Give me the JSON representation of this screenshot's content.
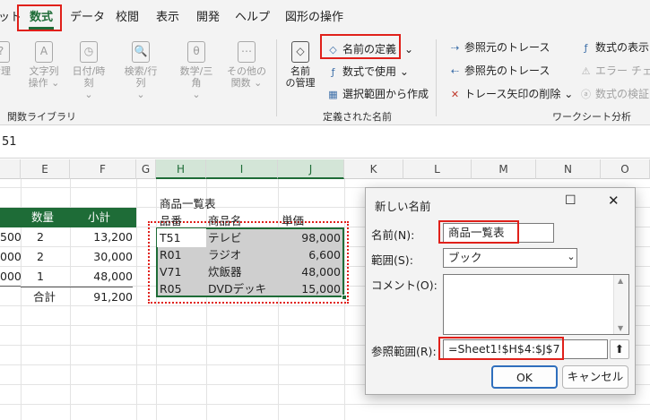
{
  "tabs": [
    {
      "label": "ット",
      "key": "layout"
    },
    {
      "label": "数式",
      "key": "formulas"
    },
    {
      "label": "データ",
      "key": "data"
    },
    {
      "label": "校閲",
      "key": "review"
    },
    {
      "label": "表示",
      "key": "view"
    },
    {
      "label": "開発",
      "key": "developer"
    },
    {
      "label": "ヘルプ",
      "key": "help"
    },
    {
      "label": "図形の操作",
      "key": "shape"
    }
  ],
  "ribbon": {
    "function_library": {
      "group_label": "関数ライブラリ",
      "buttons": [
        {
          "line1": "論理",
          "line2": "",
          "icon": "?"
        },
        {
          "line1": "文字列",
          "line2": "操作 ⌄",
          "icon": "A"
        },
        {
          "line1": "日付/時刻",
          "line2": "⌄",
          "icon": "◷"
        },
        {
          "line1": "検索/行列",
          "line2": "⌄",
          "icon": "🔍"
        },
        {
          "line1": "数学/三角",
          "line2": "⌄",
          "icon": "θ"
        },
        {
          "line1": "その他の",
          "line2": "関数 ⌄",
          "icon": "⋯"
        }
      ]
    },
    "defined_names": {
      "group_label": "定義された名前",
      "name_manager_line1": "名前",
      "name_manager_line2": "の管理",
      "define_name": "名前の定義",
      "use_in_formula": "数式で使用",
      "create_from_selection": "選択範囲から作成"
    },
    "formula_auditing": {
      "group_label": "ワークシート分析",
      "trace_precedents": "参照元のトレース",
      "trace_dependents": "参照先のトレース",
      "remove_arrows": "トレース矢印の削除",
      "show_formulas": "数式の表示",
      "error_checking": "エラー チェック",
      "evaluate_formula": "数式の検証"
    }
  },
  "formula_bar": {
    "value": "51"
  },
  "columns": [
    "E",
    "F",
    "G",
    "H",
    "I",
    "J",
    "K",
    "L",
    "M",
    "N",
    "O"
  ],
  "left_table": {
    "headers": [
      "数量",
      "小計"
    ],
    "rows": [
      {
        "a": "500",
        "qty": "2",
        "subtotal": "13,200"
      },
      {
        "a": "000",
        "qty": "2",
        "subtotal": "30,000"
      },
      {
        "a": "000",
        "qty": "1",
        "subtotal": "48,000"
      }
    ],
    "total_label": "合計",
    "total_value": "91,200"
  },
  "product_table": {
    "title": "商品一覧表",
    "headers": [
      "品番",
      "商品名",
      "単価"
    ],
    "rows": [
      {
        "code": "T51",
        "name": "テレビ",
        "price": "98,000"
      },
      {
        "code": "R01",
        "name": "ラジオ",
        "price": "6,600"
      },
      {
        "code": "V71",
        "name": "炊飯器",
        "price": "48,000"
      },
      {
        "code": "R05",
        "name": "DVDデッキ",
        "price": "15,000"
      }
    ]
  },
  "dialog": {
    "title": "新しい名前",
    "name_label": "名前(N):",
    "name_value": "商品一覧表",
    "scope_label": "範囲(S):",
    "scope_value": "ブック",
    "comment_label": "コメント(O):",
    "ref_label": "参照範囲(R):",
    "ref_value": "=Sheet1!$H$4:$J$7",
    "ok_label": "OK",
    "cancel_label": "キャンセル"
  },
  "colors": {
    "accent": "#1e6c37",
    "highlight": "#e0201a"
  }
}
